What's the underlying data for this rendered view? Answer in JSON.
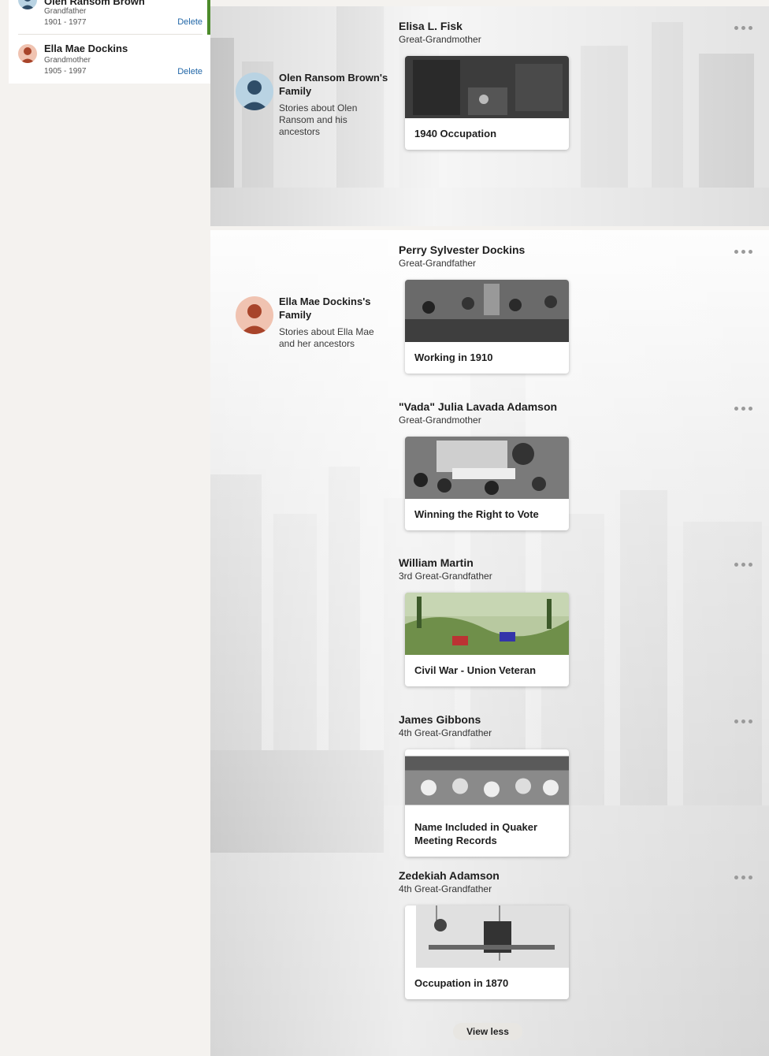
{
  "sidebar": {
    "people": [
      {
        "name": "Olen Ransom Brown",
        "relation": "Grandfather",
        "dates": "1901 - 1977",
        "action": "Delete"
      },
      {
        "name": "Ella Mae Dockins",
        "relation": "Grandmother",
        "dates": "1905 - 1997",
        "action": "Delete"
      }
    ]
  },
  "families": [
    {
      "title": "Olen Ransom Brown's Family",
      "description": "Stories about Olen Ransom and his ancestors",
      "ancestors": [
        {
          "name": "Elisa L. Fisk",
          "relation": "Great-Grandmother",
          "story": "1940 Occupation"
        }
      ]
    },
    {
      "title": "Ella Mae Dockins's Family",
      "description": "Stories about Ella Mae and her ancestors",
      "ancestors": [
        {
          "name": "Perry Sylvester Dockins",
          "relation": "Great-Grandfather",
          "story": "Working in 1910"
        },
        {
          "name": "\"Vada\" Julia Lavada Adamson",
          "relation": "Great-Grandmother",
          "story": "Winning the Right to Vote"
        },
        {
          "name": "William Martin",
          "relation": "3rd Great-Grandfather",
          "story": "Civil War - Union Veteran"
        },
        {
          "name": "James Gibbons",
          "relation": "4th Great-Grandfather",
          "story": "Name Included in Quaker Meeting Records"
        },
        {
          "name": "Zedekiah Adamson",
          "relation": "4th Great-Grandfather",
          "story": "Occupation in 1870"
        }
      ]
    }
  ],
  "view_less_label": "View less",
  "colors": {
    "accent_green": "#4c8b2b",
    "link_blue": "#2167a8",
    "sidebar_bg": "#f4f2ef"
  },
  "icons": [
    "more-options-icon",
    "male-avatar-icon",
    "female-avatar-icon"
  ]
}
